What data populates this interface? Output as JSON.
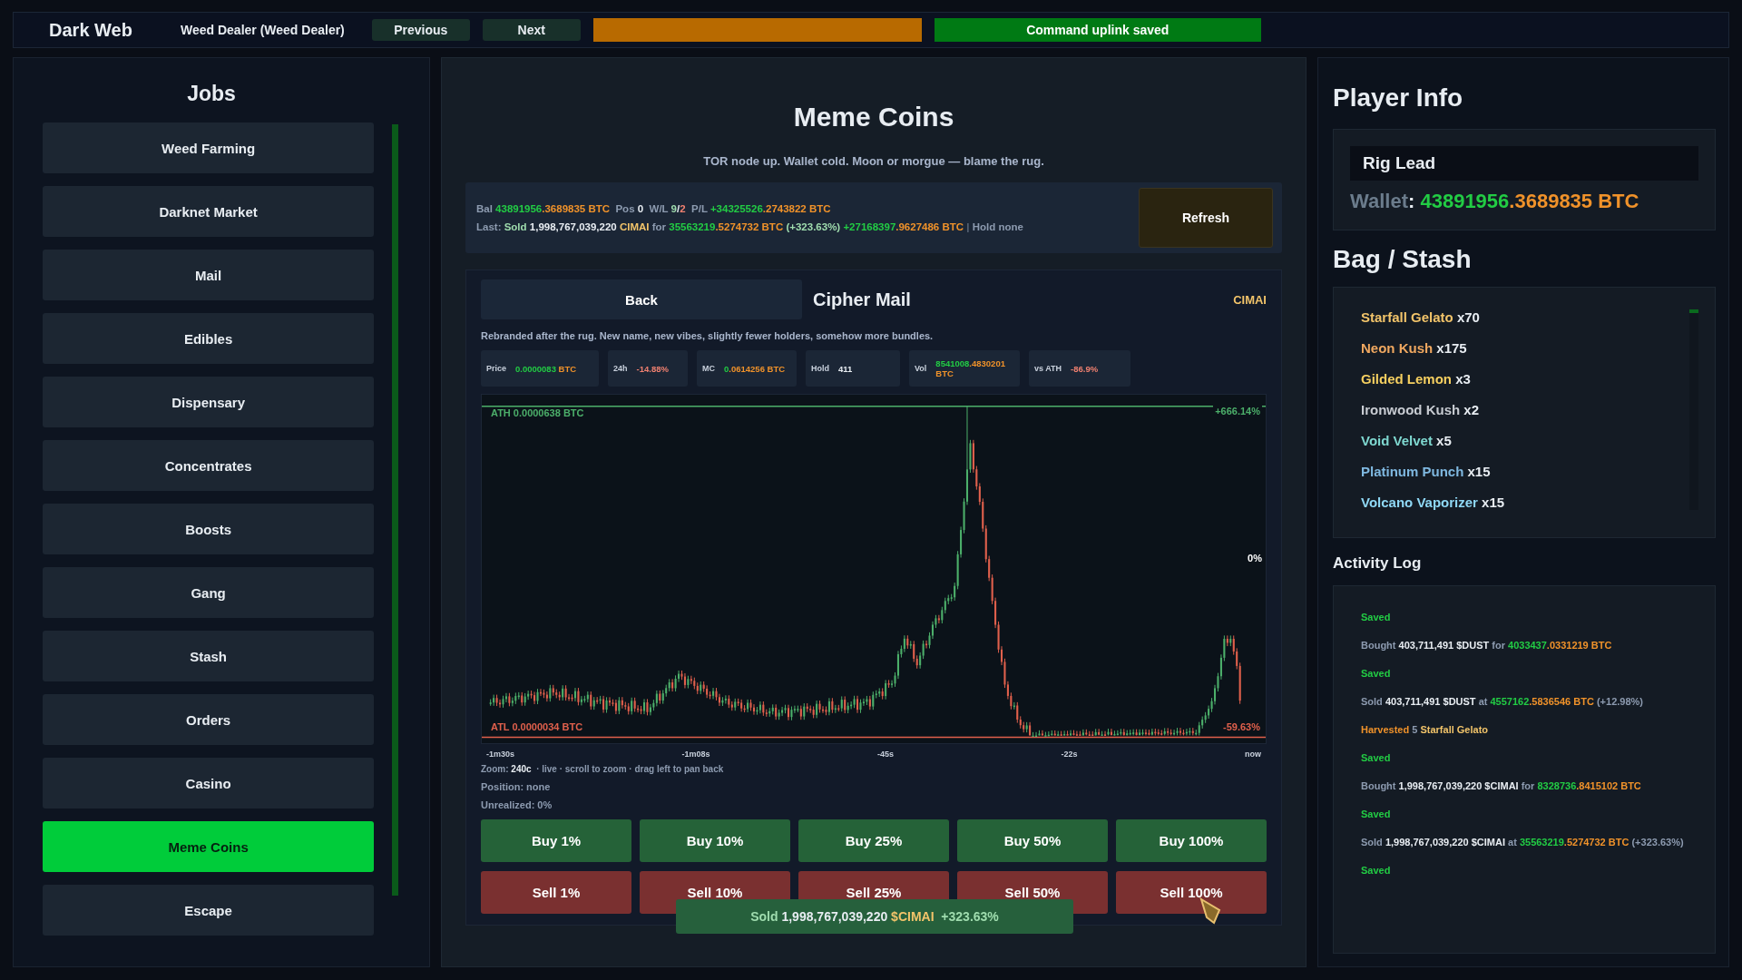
{
  "topbar": {
    "title": "Dark Web",
    "character": "Weed Dealer (Weed Dealer)",
    "buttons": [
      "Previous",
      "Next"
    ],
    "status": "Command uplink saved"
  },
  "jobs": {
    "title": "Jobs",
    "items": [
      {
        "label": "Weed Farming",
        "selected": false
      },
      {
        "label": "Darknet Market",
        "selected": false
      },
      {
        "label": "Mail",
        "selected": false
      },
      {
        "label": "Edibles",
        "selected": false
      },
      {
        "label": "Dispensary",
        "selected": false
      },
      {
        "label": "Concentrates",
        "selected": false
      },
      {
        "label": "Boosts",
        "selected": false
      },
      {
        "label": "Gang",
        "selected": false
      },
      {
        "label": "Stash",
        "selected": false
      },
      {
        "label": "Orders",
        "selected": false
      },
      {
        "label": "Casino",
        "selected": false
      },
      {
        "label": "Meme Coins",
        "selected": true
      },
      {
        "label": "Escape",
        "selected": false
      }
    ]
  },
  "market": {
    "title": "Meme Coins",
    "tagline": "TOR node up. Wallet cold. Moon or morgue — blame the rug.",
    "summary": [
      [
        {
          "t": "Bal ",
          "kind": "muted"
        },
        {
          "t": "43891956",
          "kind": "green"
        },
        {
          "t": ".3689835 BTC",
          "kind": "orange"
        },
        {
          "t": "  Pos ",
          "kind": "muted"
        },
        {
          "t": "0",
          "kind": "white"
        },
        {
          "t": "  W/L ",
          "kind": "muted"
        },
        {
          "t": "9",
          "kind": "lightgreen"
        },
        {
          "t": "/",
          "kind": "white"
        },
        {
          "t": "2",
          "kind": "red"
        },
        {
          "t": "  P/L ",
          "kind": "muted"
        },
        {
          "t": "+34325526",
          "kind": "green"
        },
        {
          "t": ".2743822 BTC",
          "kind": "orange"
        }
      ],
      [
        {
          "t": "Last: ",
          "kind": "muted"
        },
        {
          "t": "Sold ",
          "kind": "lightgreen"
        },
        {
          "t": "1,998,767,039,220 ",
          "kind": "white"
        },
        {
          "t": "CIMAI ",
          "kind": "gold"
        },
        {
          "t": "for ",
          "kind": "muted"
        },
        {
          "t": "35563219",
          "kind": "green"
        },
        {
          "t": ".5274732 BTC ",
          "kind": "orange"
        },
        {
          "t": "(+323.63%) ",
          "kind": "lightgreen"
        },
        {
          "t": "+27168397",
          "kind": "green"
        },
        {
          "t": ".9627486 BTC",
          "kind": "orange"
        },
        {
          "t": " | ",
          "kind": "dim"
        },
        {
          "t": "Hold none",
          "kind": "muted"
        }
      ]
    ],
    "refresh": "Refresh",
    "coin": {
      "back": "Back",
      "name": "Cipher Mail",
      "ticker": "CIMAI",
      "description": "Rebranded after the rug. New name, new vibes, slightly fewer holders, somehow more bundles.",
      "metrics": [
        {
          "label": "Price",
          "value": [
            {
              "t": "0.0000083 ",
              "kind": "green"
            },
            {
              "t": "BTC",
              "kind": "orange"
            }
          ]
        },
        {
          "label": "24h",
          "value": [
            {
              "t": "-14.88%",
              "kind": "red"
            }
          ]
        },
        {
          "label": "MC",
          "value": [
            {
              "t": "0",
              "kind": "green"
            },
            {
              "t": ".0614256 BTC",
              "kind": "orange"
            }
          ]
        },
        {
          "label": "Hold",
          "value": [
            {
              "t": "411",
              "kind": "white"
            }
          ]
        },
        {
          "label": "Vol",
          "value": [
            {
              "t": "8541008",
              "kind": "green"
            },
            {
              "t": ".4830201 BTC",
              "kind": "orange"
            }
          ]
        },
        {
          "label": "vs ATH",
          "value": [
            {
              "t": "-86.9%",
              "kind": "red"
            }
          ]
        }
      ],
      "chart": {
        "ath_label": "ATH 0.0000638 BTC",
        "atl_label": "ATL 0.0000034 BTC",
        "top_pct": "+666.14%",
        "mid_pct": "0%",
        "bottom_pct": "-59.63%",
        "time_labels": [
          "-1m30s",
          "-1m08s",
          "-45s",
          "-22s",
          "now"
        ]
      },
      "zoom": [
        {
          "t": "Zoom: ",
          "kind": "muted"
        },
        {
          "t": "240c",
          "kind": "white"
        },
        {
          "t": "  · live · scroll to zoom · drag left to pan back",
          "kind": "muted"
        }
      ],
      "position": [
        {
          "t": "Position: ",
          "kind": "muted"
        },
        {
          "t": "none",
          "kind": "muted"
        }
      ],
      "unrealized": [
        {
          "t": "Unrealized: ",
          "kind": "muted"
        },
        {
          "t": "0%",
          "kind": "muted"
        }
      ],
      "buy_buttons": [
        "Buy 1%",
        "Buy 10%",
        "Buy 25%",
        "Buy 50%",
        "Buy 100%"
      ],
      "sell_buttons": [
        "Sell 1%",
        "Sell 10%",
        "Sell 25%",
        "Sell 50%",
        "Sell 100%"
      ]
    },
    "toast": [
      {
        "t": "Sold ",
        "kind": "lightgreen"
      },
      {
        "t": "1,998,767,039,220 ",
        "kind": "white"
      },
      {
        "t": "$CIMAI ",
        "kind": "gold"
      },
      {
        "t": " +323.63%",
        "kind": "lightgreen"
      }
    ]
  },
  "player": {
    "title": "Player Info",
    "role": "Rig Lead",
    "wallet": [
      {
        "t": "Wallet",
        "kind": "slate"
      },
      {
        "t": ": ",
        "kind": "white"
      },
      {
        "t": "43891956",
        "kind": "green"
      },
      {
        "t": ".3689835 BTC",
        "kind": "orange"
      }
    ]
  },
  "bag": {
    "title": "Bag / Stash",
    "items": [
      {
        "name": "Starfall Gelato",
        "count": "x70",
        "color": "#f2c46a"
      },
      {
        "name": "Neon Kush",
        "count": "x175",
        "color": "#f0a860"
      },
      {
        "name": "Gilded Lemon",
        "count": "x3",
        "color": "#f5cf60"
      },
      {
        "name": "Ironwood Kush",
        "count": "x2",
        "color": "#c8ccd2"
      },
      {
        "name": "Void Velvet",
        "count": "x5",
        "color": "#7fd8d0"
      },
      {
        "name": "Platinum Punch",
        "count": "x15",
        "color": "#7fb8e0"
      },
      {
        "name": "Volcano Vaporizer",
        "count": "x15",
        "color": "#8fd8f5"
      }
    ]
  },
  "log": {
    "title": "Activity Log",
    "entries": [
      [
        {
          "t": "Saved",
          "kind": "saved"
        }
      ],
      [
        {
          "t": "Bought ",
          "kind": "muted"
        },
        {
          "t": "403,711,491 $DUST ",
          "kind": "white"
        },
        {
          "t": "for ",
          "kind": "muted"
        },
        {
          "t": "4033437",
          "kind": "green"
        },
        {
          "t": ".0331219 BTC",
          "kind": "orange"
        }
      ],
      [
        {
          "t": "Saved",
          "kind": "saved"
        }
      ],
      [
        {
          "t": "Sold ",
          "kind": "muted"
        },
        {
          "t": "403,711,491 $DUST ",
          "kind": "white"
        },
        {
          "t": "at ",
          "kind": "muted"
        },
        {
          "t": "4557162",
          "kind": "green"
        },
        {
          "t": ".5836546 BTC ",
          "kind": "orange"
        },
        {
          "t": "(+12.98%)",
          "kind": "muted"
        }
      ],
      [
        {
          "t": "Harvested ",
          "kind": "orange"
        },
        {
          "t": "5 ",
          "kind": "muted"
        },
        {
          "t": "Starfall Gelato",
          "kind": "gold"
        }
      ],
      [
        {
          "t": "Saved",
          "kind": "saved"
        }
      ],
      [
        {
          "t": "Bought ",
          "kind": "muted"
        },
        {
          "t": "1,998,767,039,220 $CIMAI ",
          "kind": "white"
        },
        {
          "t": "for ",
          "kind": "muted"
        },
        {
          "t": "8328736",
          "kind": "green"
        },
        {
          "t": ".8415102 BTC",
          "kind": "orange"
        }
      ],
      [
        {
          "t": "Saved",
          "kind": "saved"
        }
      ],
      [
        {
          "t": "Sold ",
          "kind": "muted"
        },
        {
          "t": "1,998,767,039,220 $CIMAI ",
          "kind": "white"
        },
        {
          "t": "at ",
          "kind": "muted"
        },
        {
          "t": "35563219",
          "kind": "green"
        },
        {
          "t": ".5274732 BTC ",
          "kind": "orange"
        },
        {
          "t": "(+323.63%)",
          "kind": "muted"
        }
      ],
      [
        {
          "t": "Saved",
          "kind": "saved"
        }
      ]
    ]
  }
}
